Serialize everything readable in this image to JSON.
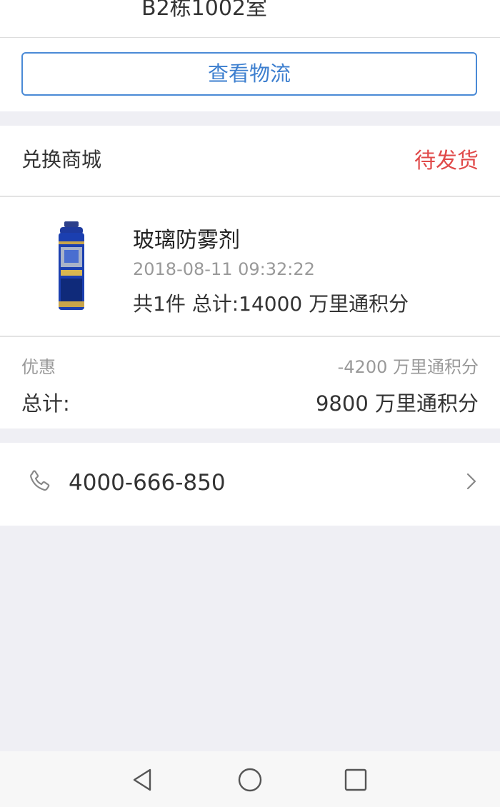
{
  "address": {
    "text": "B2栋1002室"
  },
  "logistics_button": {
    "label": "查看物流"
  },
  "order": {
    "store_name": "兑换商城",
    "status": "待发货",
    "product": {
      "name": "玻璃防雾剂",
      "time": "2018-08-11 09:32:22",
      "total_line": "共1件 总计:14000 万里通积分"
    },
    "discount": {
      "label": "优惠",
      "value": "-4200 万里通积分"
    },
    "total": {
      "label": "总计:",
      "value": "9800 万里通积分"
    }
  },
  "contact": {
    "phone": "4000-666-850",
    "phone_icon": "phone-icon",
    "chevron_icon": "chevron-right-icon"
  },
  "colors": {
    "accent_blue": "#3d7fcf",
    "status_red": "#e04a4a",
    "page_bg": "#efeff4"
  },
  "nav": {
    "back_icon": "back-triangle-icon",
    "home_icon": "home-circle-icon",
    "recent_icon": "recent-square-icon"
  }
}
